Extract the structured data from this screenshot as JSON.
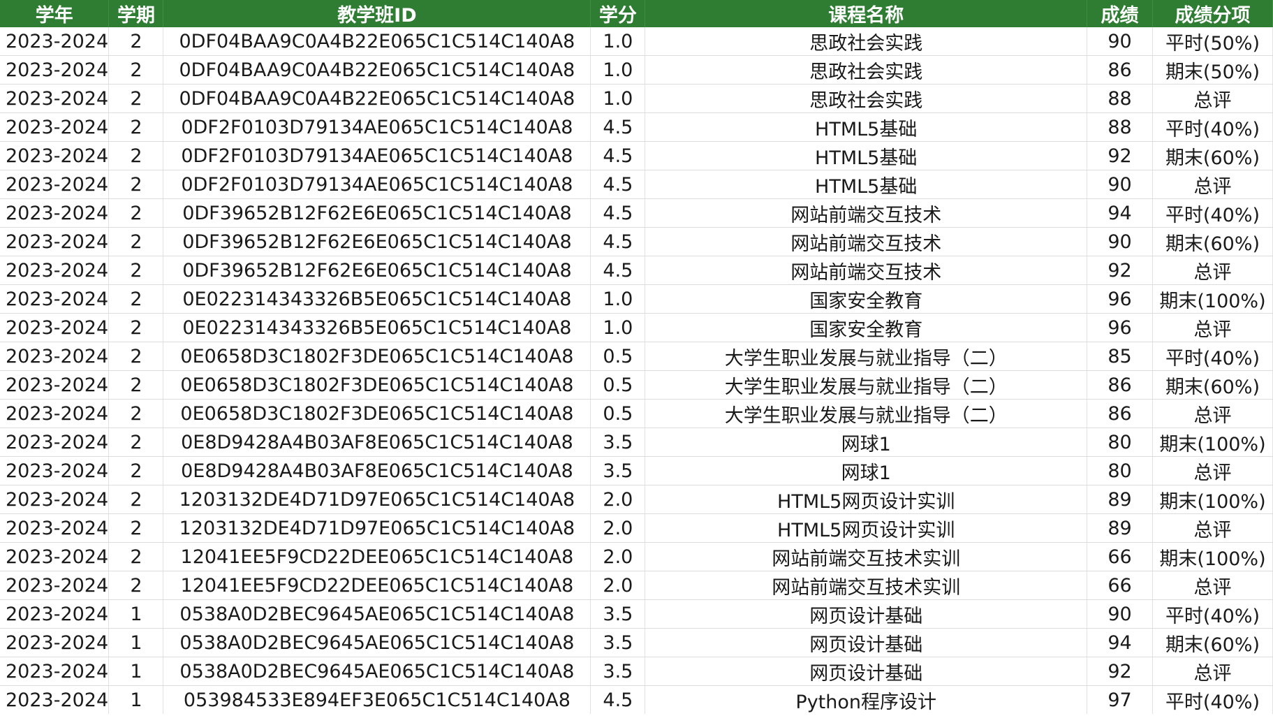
{
  "columns": [
    "学年",
    "学期",
    "教学班ID",
    "学分",
    "课程名称",
    "成绩",
    "成绩分项"
  ],
  "rows": [
    [
      "2023-2024",
      "2",
      "0DF04BAA9C0A4B22E065C1C514C140A8",
      "1.0",
      "思政社会实践",
      "90",
      "平时(50%)"
    ],
    [
      "2023-2024",
      "2",
      "0DF04BAA9C0A4B22E065C1C514C140A8",
      "1.0",
      "思政社会实践",
      "86",
      "期末(50%)"
    ],
    [
      "2023-2024",
      "2",
      "0DF04BAA9C0A4B22E065C1C514C140A8",
      "1.0",
      "思政社会实践",
      "88",
      "总评"
    ],
    [
      "2023-2024",
      "2",
      "0DF2F0103D79134AE065C1C514C140A8",
      "4.5",
      "HTML5基础",
      "88",
      "平时(40%)"
    ],
    [
      "2023-2024",
      "2",
      "0DF2F0103D79134AE065C1C514C140A8",
      "4.5",
      "HTML5基础",
      "92",
      "期末(60%)"
    ],
    [
      "2023-2024",
      "2",
      "0DF2F0103D79134AE065C1C514C140A8",
      "4.5",
      "HTML5基础",
      "90",
      "总评"
    ],
    [
      "2023-2024",
      "2",
      "0DF39652B12F62E6E065C1C514C140A8",
      "4.5",
      "网站前端交互技术",
      "94",
      "平时(40%)"
    ],
    [
      "2023-2024",
      "2",
      "0DF39652B12F62E6E065C1C514C140A8",
      "4.5",
      "网站前端交互技术",
      "90",
      "期末(60%)"
    ],
    [
      "2023-2024",
      "2",
      "0DF39652B12F62E6E065C1C514C140A8",
      "4.5",
      "网站前端交互技术",
      "92",
      "总评"
    ],
    [
      "2023-2024",
      "2",
      "0E022314343326B5E065C1C514C140A8",
      "1.0",
      "国家安全教育",
      "96",
      "期末(100%)"
    ],
    [
      "2023-2024",
      "2",
      "0E022314343326B5E065C1C514C140A8",
      "1.0",
      "国家安全教育",
      "96",
      "总评"
    ],
    [
      "2023-2024",
      "2",
      "0E0658D3C1802F3DE065C1C514C140A8",
      "0.5",
      "大学生职业发展与就业指导（二）",
      "85",
      "平时(40%)"
    ],
    [
      "2023-2024",
      "2",
      "0E0658D3C1802F3DE065C1C514C140A8",
      "0.5",
      "大学生职业发展与就业指导（二）",
      "86",
      "期末(60%)"
    ],
    [
      "2023-2024",
      "2",
      "0E0658D3C1802F3DE065C1C514C140A8",
      "0.5",
      "大学生职业发展与就业指导（二）",
      "86",
      "总评"
    ],
    [
      "2023-2024",
      "2",
      "0E8D9428A4B03AF8E065C1C514C140A8",
      "3.5",
      "网球1",
      "80",
      "期末(100%)"
    ],
    [
      "2023-2024",
      "2",
      "0E8D9428A4B03AF8E065C1C514C140A8",
      "3.5",
      "网球1",
      "80",
      "总评"
    ],
    [
      "2023-2024",
      "2",
      "1203132DE4D71D97E065C1C514C140A8",
      "2.0",
      "HTML5网页设计实训",
      "89",
      "期末(100%)"
    ],
    [
      "2023-2024",
      "2",
      "1203132DE4D71D97E065C1C514C140A8",
      "2.0",
      "HTML5网页设计实训",
      "89",
      "总评"
    ],
    [
      "2023-2024",
      "2",
      "12041EE5F9CD22DEE065C1C514C140A8",
      "2.0",
      "网站前端交互技术实训",
      "66",
      "期末(100%)"
    ],
    [
      "2023-2024",
      "2",
      "12041EE5F9CD22DEE065C1C514C140A8",
      "2.0",
      "网站前端交互技术实训",
      "66",
      "总评"
    ],
    [
      "2023-2024",
      "1",
      "0538A0D2BEC9645AE065C1C514C140A8",
      "3.5",
      "网页设计基础",
      "90",
      "平时(40%)"
    ],
    [
      "2023-2024",
      "1",
      "0538A0D2BEC9645AE065C1C514C140A8",
      "3.5",
      "网页设计基础",
      "94",
      "期末(60%)"
    ],
    [
      "2023-2024",
      "1",
      "0538A0D2BEC9645AE065C1C514C140A8",
      "3.5",
      "网页设计基础",
      "92",
      "总评"
    ],
    [
      "2023-2024",
      "1",
      "053984533E894EF3E065C1C514C140A8",
      "4.5",
      "Python程序设计",
      "97",
      "平时(40%)"
    ]
  ]
}
